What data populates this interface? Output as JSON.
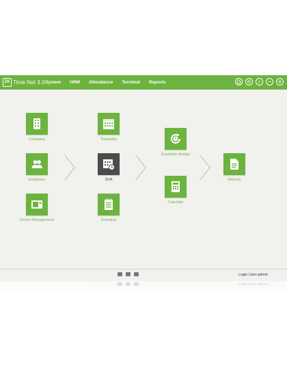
{
  "app": {
    "logo_mark": "ZK",
    "logo_text": "Time.Net 3.0"
  },
  "menu": [
    "System",
    "HRM",
    "Attendance",
    "Terminal",
    "Reports"
  ],
  "tools": [
    {
      "icon": "home-icon"
    },
    {
      "icon": "settings-icon"
    },
    {
      "icon": "info-icon"
    },
    {
      "icon": "minimize-icon"
    },
    {
      "icon": "close-icon"
    }
  ],
  "modules": {
    "company": "Company",
    "employee": "Employee",
    "device_management": "Device Management",
    "timetable": "Timetable",
    "shift": "Shift",
    "schedule": "Schedule",
    "exception_assign": "Exception Assign",
    "calculate": "Calculate",
    "reports": "Reports"
  },
  "footer": {
    "login_user": "Login User:admin"
  },
  "colors": {
    "accent": "#6db33f",
    "dark_tile": "#4c4c4c",
    "background": "#f1f1ee"
  }
}
